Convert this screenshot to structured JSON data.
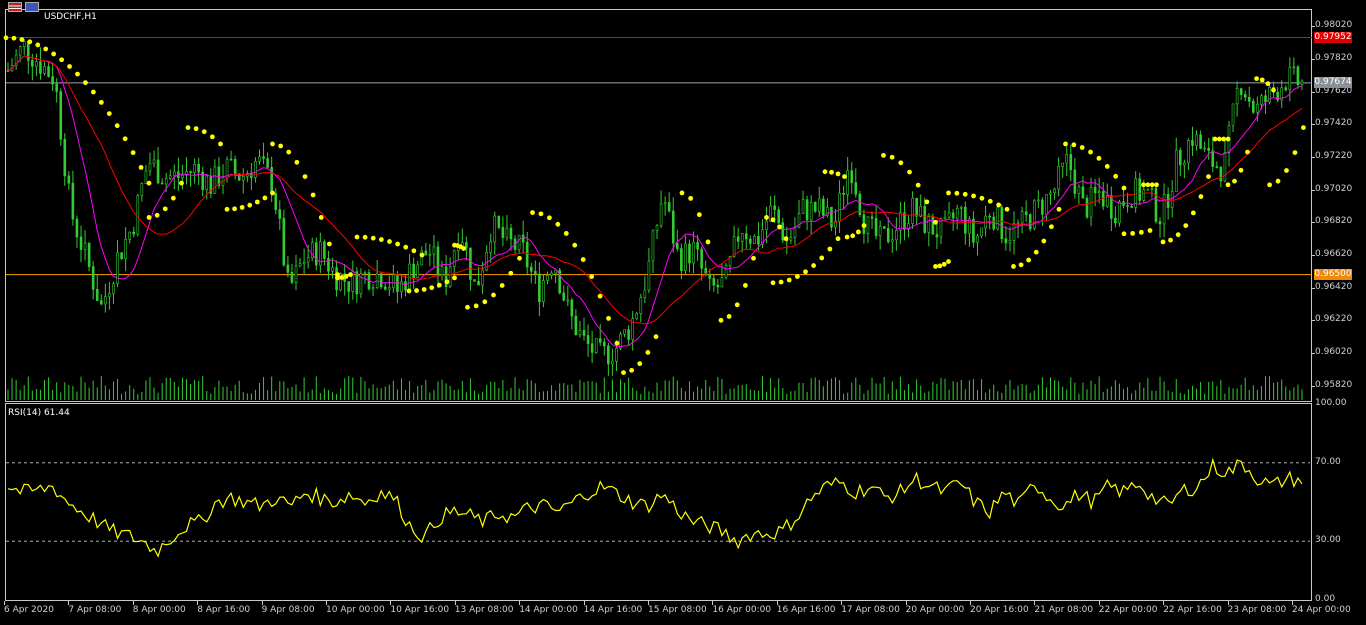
{
  "window": {
    "symbol_label": "USDCHF,H1",
    "icons": [
      "flag-us-icon",
      "flag-ch-icon"
    ]
  },
  "rsi": {
    "label": "RSI(14) 61.44",
    "yticks": [
      "100.00",
      "70.00",
      "30.00",
      "0.00"
    ]
  },
  "price_axis": {
    "ticks": [
      "0.98020",
      "0.97820",
      "0.97620",
      "0.97420",
      "0.97220",
      "0.97020",
      "0.96820",
      "0.96620",
      "0.96420",
      "0.96220",
      "0.96020",
      "0.95820"
    ],
    "tags": {
      "red_line": "0.97952",
      "current": "0.97674",
      "orange_line": "0.96500"
    }
  },
  "time_axis": {
    "labels": [
      "6 Apr 2020",
      "7 Apr 08:00",
      "8 Apr 00:00",
      "8 Apr 16:00",
      "9 Apr 08:00",
      "10 Apr 00:00",
      "10 Apr 16:00",
      "13 Apr 08:00",
      "14 Apr 00:00",
      "14 Apr 16:00",
      "15 Apr 08:00",
      "16 Apr 00:00",
      "16 Apr 16:00",
      "17 Apr 08:00",
      "20 Apr 00:00",
      "20 Apr 16:00",
      "21 Apr 08:00",
      "22 Apr 00:00",
      "22 Apr 16:00",
      "23 Apr 08:00",
      "24 Apr 00:00"
    ]
  },
  "colors": {
    "background": "#000000",
    "candles": "#32cd32",
    "sar": "#ffff00",
    "ma_fast": "#ff00ff",
    "ma_slow": "#ff0000",
    "red_line": "#ff0000",
    "current_line": "#9aa5b0",
    "orange_line": "#ffa500",
    "rsi": "#ffff00",
    "volume": "#32cd32"
  },
  "chart_data": [
    {
      "type": "line",
      "title": "USDCHF,H1",
      "ylim": [
        0.9572,
        0.9812
      ],
      "x_start": "6 Apr 2020",
      "x_end": "24 Apr 00:00",
      "horizontal_lines": [
        0.97952,
        0.97674,
        0.965
      ],
      "price_path": [
        0.9775,
        0.979,
        0.978,
        0.977,
        0.969,
        0.966,
        0.963,
        0.966,
        0.968,
        0.972,
        0.971,
        0.971,
        0.9715,
        0.9705,
        0.9715,
        0.971,
        0.972,
        0.9705,
        0.964,
        0.966,
        0.9665,
        0.965,
        0.9645,
        0.965,
        0.965,
        0.964,
        0.9655,
        0.9665,
        0.9645,
        0.968,
        0.964,
        0.968,
        0.967,
        0.9665,
        0.964,
        0.966,
        0.9625,
        0.9608,
        0.96,
        0.9605,
        0.962,
        0.965,
        0.97,
        0.966,
        0.9665,
        0.964,
        0.9645,
        0.968,
        0.967,
        0.969,
        0.967,
        0.969,
        0.969,
        0.968,
        0.972,
        0.968,
        0.967,
        0.968,
        0.969,
        0.968,
        0.9675,
        0.969,
        0.967,
        0.969,
        0.9675,
        0.968,
        0.969,
        0.97,
        0.972,
        0.969,
        0.97,
        0.969,
        0.97,
        0.97,
        0.9685,
        0.972,
        0.9735,
        0.972,
        0.9715,
        0.977,
        0.975,
        0.976,
        0.977,
        0.9767
      ],
      "sar_segments": [
        {
          "dir": "above",
          "x0": 0.0,
          "x1": 0.11,
          "y0": 0.9795,
          "y1": 0.9706
        },
        {
          "dir": "below",
          "x0": 0.11,
          "x1": 0.135,
          "y0": 0.9685,
          "y1": 0.9706
        },
        {
          "dir": "above",
          "x0": 0.14,
          "x1": 0.165,
          "y0": 0.974,
          "y1": 0.973
        },
        {
          "dir": "below",
          "x0": 0.17,
          "x1": 0.205,
          "y0": 0.969,
          "y1": 0.97
        },
        {
          "dir": "above",
          "x0": 0.205,
          "x1": 0.255,
          "y0": 0.973,
          "y1": 0.965
        },
        {
          "dir": "below",
          "x0": 0.255,
          "x1": 0.265,
          "y0": 0.9648,
          "y1": 0.965
        },
        {
          "dir": "above",
          "x0": 0.27,
          "x1": 0.32,
          "y0": 0.9673,
          "y1": 0.9662
        },
        {
          "dir": "below",
          "x0": 0.31,
          "x1": 0.345,
          "y0": 0.964,
          "y1": 0.9648
        },
        {
          "dir": "above",
          "x0": 0.345,
          "x1": 0.352,
          "y0": 0.9668,
          "y1": 0.9666
        },
        {
          "dir": "below",
          "x0": 0.355,
          "x1": 0.395,
          "y0": 0.963,
          "y1": 0.966
        },
        {
          "dir": "above",
          "x0": 0.405,
          "x1": 0.47,
          "y0": 0.9688,
          "y1": 0.9608
        },
        {
          "dir": "below",
          "x0": 0.475,
          "x1": 0.5,
          "y0": 0.959,
          "y1": 0.9612
        },
        {
          "dir": "above",
          "x0": 0.52,
          "x1": 0.54,
          "y0": 0.97,
          "y1": 0.967
        },
        {
          "dir": "below",
          "x0": 0.55,
          "x1": 0.575,
          "y0": 0.9622,
          "y1": 0.966
        },
        {
          "dir": "above",
          "x0": 0.585,
          "x1": 0.6,
          "y0": 0.9685,
          "y1": 0.9672
        },
        {
          "dir": "below",
          "x0": 0.59,
          "x1": 0.64,
          "y0": 0.9645,
          "y1": 0.9672
        },
        {
          "dir": "above",
          "x0": 0.63,
          "x1": 0.645,
          "y0": 0.9713,
          "y1": 0.971
        },
        {
          "dir": "below",
          "x0": 0.647,
          "x1": 0.66,
          "y0": 0.9673,
          "y1": 0.968
        },
        {
          "dir": "above",
          "x0": 0.675,
          "x1": 0.715,
          "y0": 0.9723,
          "y1": 0.9682
        },
        {
          "dir": "below",
          "x0": 0.715,
          "x1": 0.725,
          "y0": 0.9655,
          "y1": 0.9658
        },
        {
          "dir": "above",
          "x0": 0.725,
          "x1": 0.77,
          "y0": 0.97,
          "y1": 0.969
        },
        {
          "dir": "below",
          "x0": 0.775,
          "x1": 0.81,
          "y0": 0.9655,
          "y1": 0.969
        },
        {
          "dir": "above",
          "x0": 0.815,
          "x1": 0.86,
          "y0": 0.973,
          "y1": 0.9703
        },
        {
          "dir": "below",
          "x0": 0.86,
          "x1": 0.88,
          "y0": 0.9675,
          "y1": 0.9677
        },
        {
          "dir": "above",
          "x0": 0.875,
          "x1": 0.885,
          "y0": 0.9705,
          "y1": 0.9705
        },
        {
          "dir": "below",
          "x0": 0.89,
          "x1": 0.925,
          "y0": 0.967,
          "y1": 0.971
        },
        {
          "dir": "above",
          "x0": 0.93,
          "x1": 0.94,
          "y0": 0.9733,
          "y1": 0.9733
        },
        {
          "dir": "below",
          "x0": 0.94,
          "x1": 0.955,
          "y0": 0.9705,
          "y1": 0.9725
        },
        {
          "dir": "above",
          "x0": 0.962,
          "x1": 0.975,
          "y0": 0.977,
          "y1": 0.9763
        },
        {
          "dir": "below",
          "x0": 0.972,
          "x1": 0.998,
          "y0": 0.9705,
          "y1": 0.974
        }
      ]
    },
    {
      "type": "line",
      "title": "RSI(14) 61.44",
      "ylim": [
        0,
        100
      ],
      "levels": [
        70,
        30
      ],
      "values": [
        58,
        55,
        56,
        58,
        50,
        45,
        40,
        35,
        33,
        30,
        25,
        32,
        38,
        40,
        50,
        52,
        50,
        48,
        52,
        48,
        55,
        52,
        50,
        54,
        50,
        55,
        52,
        38,
        32,
        42,
        45,
        43,
        40,
        44,
        42,
        47,
        48,
        45,
        50,
        55,
        58,
        54,
        50,
        48,
        54,
        46,
        40,
        38,
        35,
        30,
        34,
        34,
        35,
        42,
        52,
        58,
        60,
        55,
        58,
        52,
        55,
        62,
        58,
        55,
        60,
        50,
        45,
        55,
        48,
        60,
        52,
        48,
        54,
        50,
        58,
        55,
        60,
        52,
        48,
        56,
        58,
        68,
        65,
        70,
        62,
        58,
        62,
        61
      ]
    }
  ]
}
